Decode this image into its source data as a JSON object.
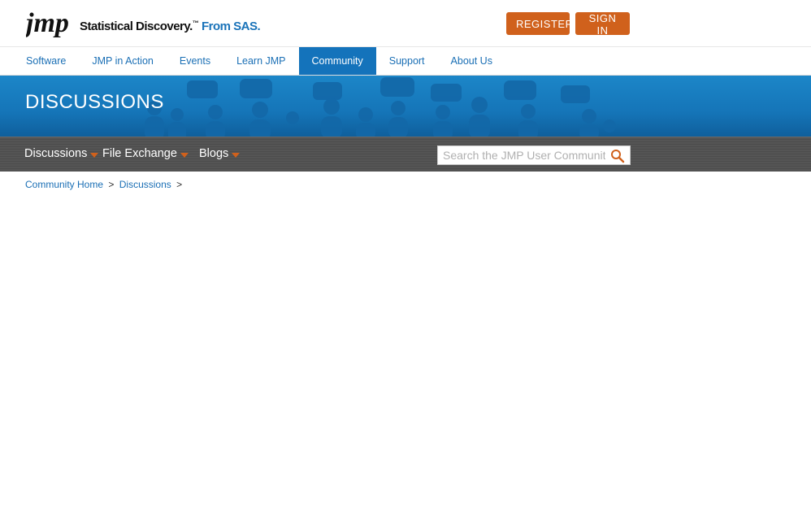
{
  "header": {
    "logo_text": "jmp",
    "tagline": "Statistical Discovery.",
    "tagline_tm": "™",
    "tagline_brand": " From SAS.",
    "register_label": "REGISTER",
    "signin_label": "SIGN IN",
    "accent_color": "#d0611c"
  },
  "mainnav": {
    "items": [
      {
        "label": "Software"
      },
      {
        "label": "JMP in Action"
      },
      {
        "label": "Events"
      },
      {
        "label": "Learn JMP"
      },
      {
        "label": "Community",
        "active": true
      },
      {
        "label": "Support"
      },
      {
        "label": "About Us"
      }
    ]
  },
  "banner": {
    "title": "DISCUSSIONS",
    "color": "#1575b8"
  },
  "subnav": {
    "items": [
      {
        "label": "Discussions"
      },
      {
        "label": "File Exchange"
      },
      {
        "label": "Blogs"
      }
    ],
    "search_placeholder": "Search the JMP User Community",
    "search_icon": "search-icon"
  },
  "breadcrumb": {
    "home": "Community Home",
    "current": "Discussions",
    "separator": ">"
  }
}
